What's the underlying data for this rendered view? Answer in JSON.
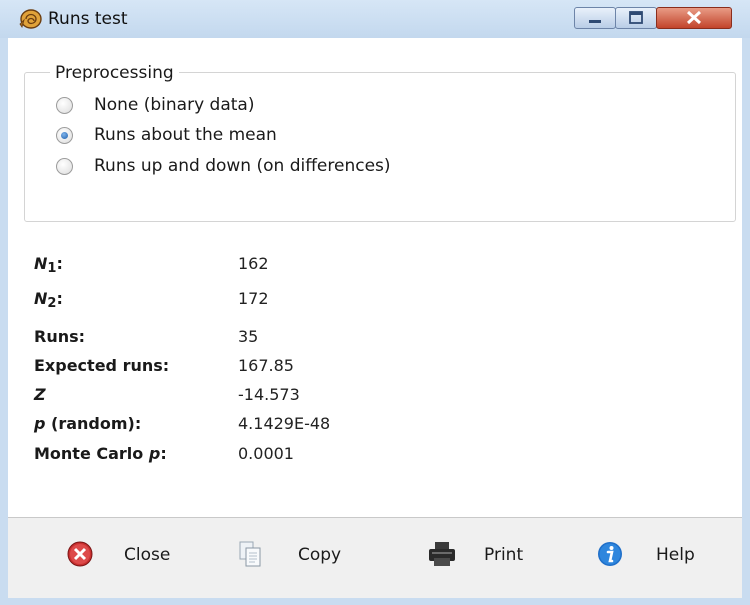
{
  "window": {
    "title": "Runs test",
    "icon": "ammonite-icon",
    "controls": [
      "minimize-icon",
      "maximize-icon",
      "close-icon"
    ]
  },
  "preprocessing": {
    "legend": "Preprocessing",
    "options": [
      {
        "label": "None (binary data)",
        "checked": false
      },
      {
        "label": "Runs about the mean",
        "checked": true
      },
      {
        "label": "Runs up and down (on differences)",
        "checked": false
      }
    ]
  },
  "stats": {
    "n1_label": "N",
    "n1_sub": "1",
    "n1_colon": ":",
    "n1_value": "162",
    "n2_label": "N",
    "n2_sub": "2",
    "n2_colon": ":",
    "n2_value": "172",
    "runs_label": "Runs:",
    "runs_value": "35",
    "expected_label": "Expected runs:",
    "expected_value": "167.85",
    "z_label": "Z",
    "z_value": "-14.573",
    "p_label_italic": "p",
    "p_label_rest": " (random):",
    "p_value": "4.1429E-48",
    "mc_label": "Monte Carlo ",
    "mc_label_italic": "p",
    "mc_colon": ":",
    "mc_value": "0.0001"
  },
  "buttons": {
    "close": {
      "label": "Close",
      "icon": "close-circle-icon"
    },
    "copy": {
      "label": "Copy",
      "icon": "copy-icon"
    },
    "print": {
      "label": "Print",
      "icon": "printer-icon"
    },
    "help": {
      "label": "Help",
      "icon": "info-icon"
    }
  },
  "colors": {
    "title_bar": "#c9dcf0",
    "close_button": "#c2442b",
    "radio_checked": "#1f5faa",
    "button_bar": "#f0f0f0"
  }
}
